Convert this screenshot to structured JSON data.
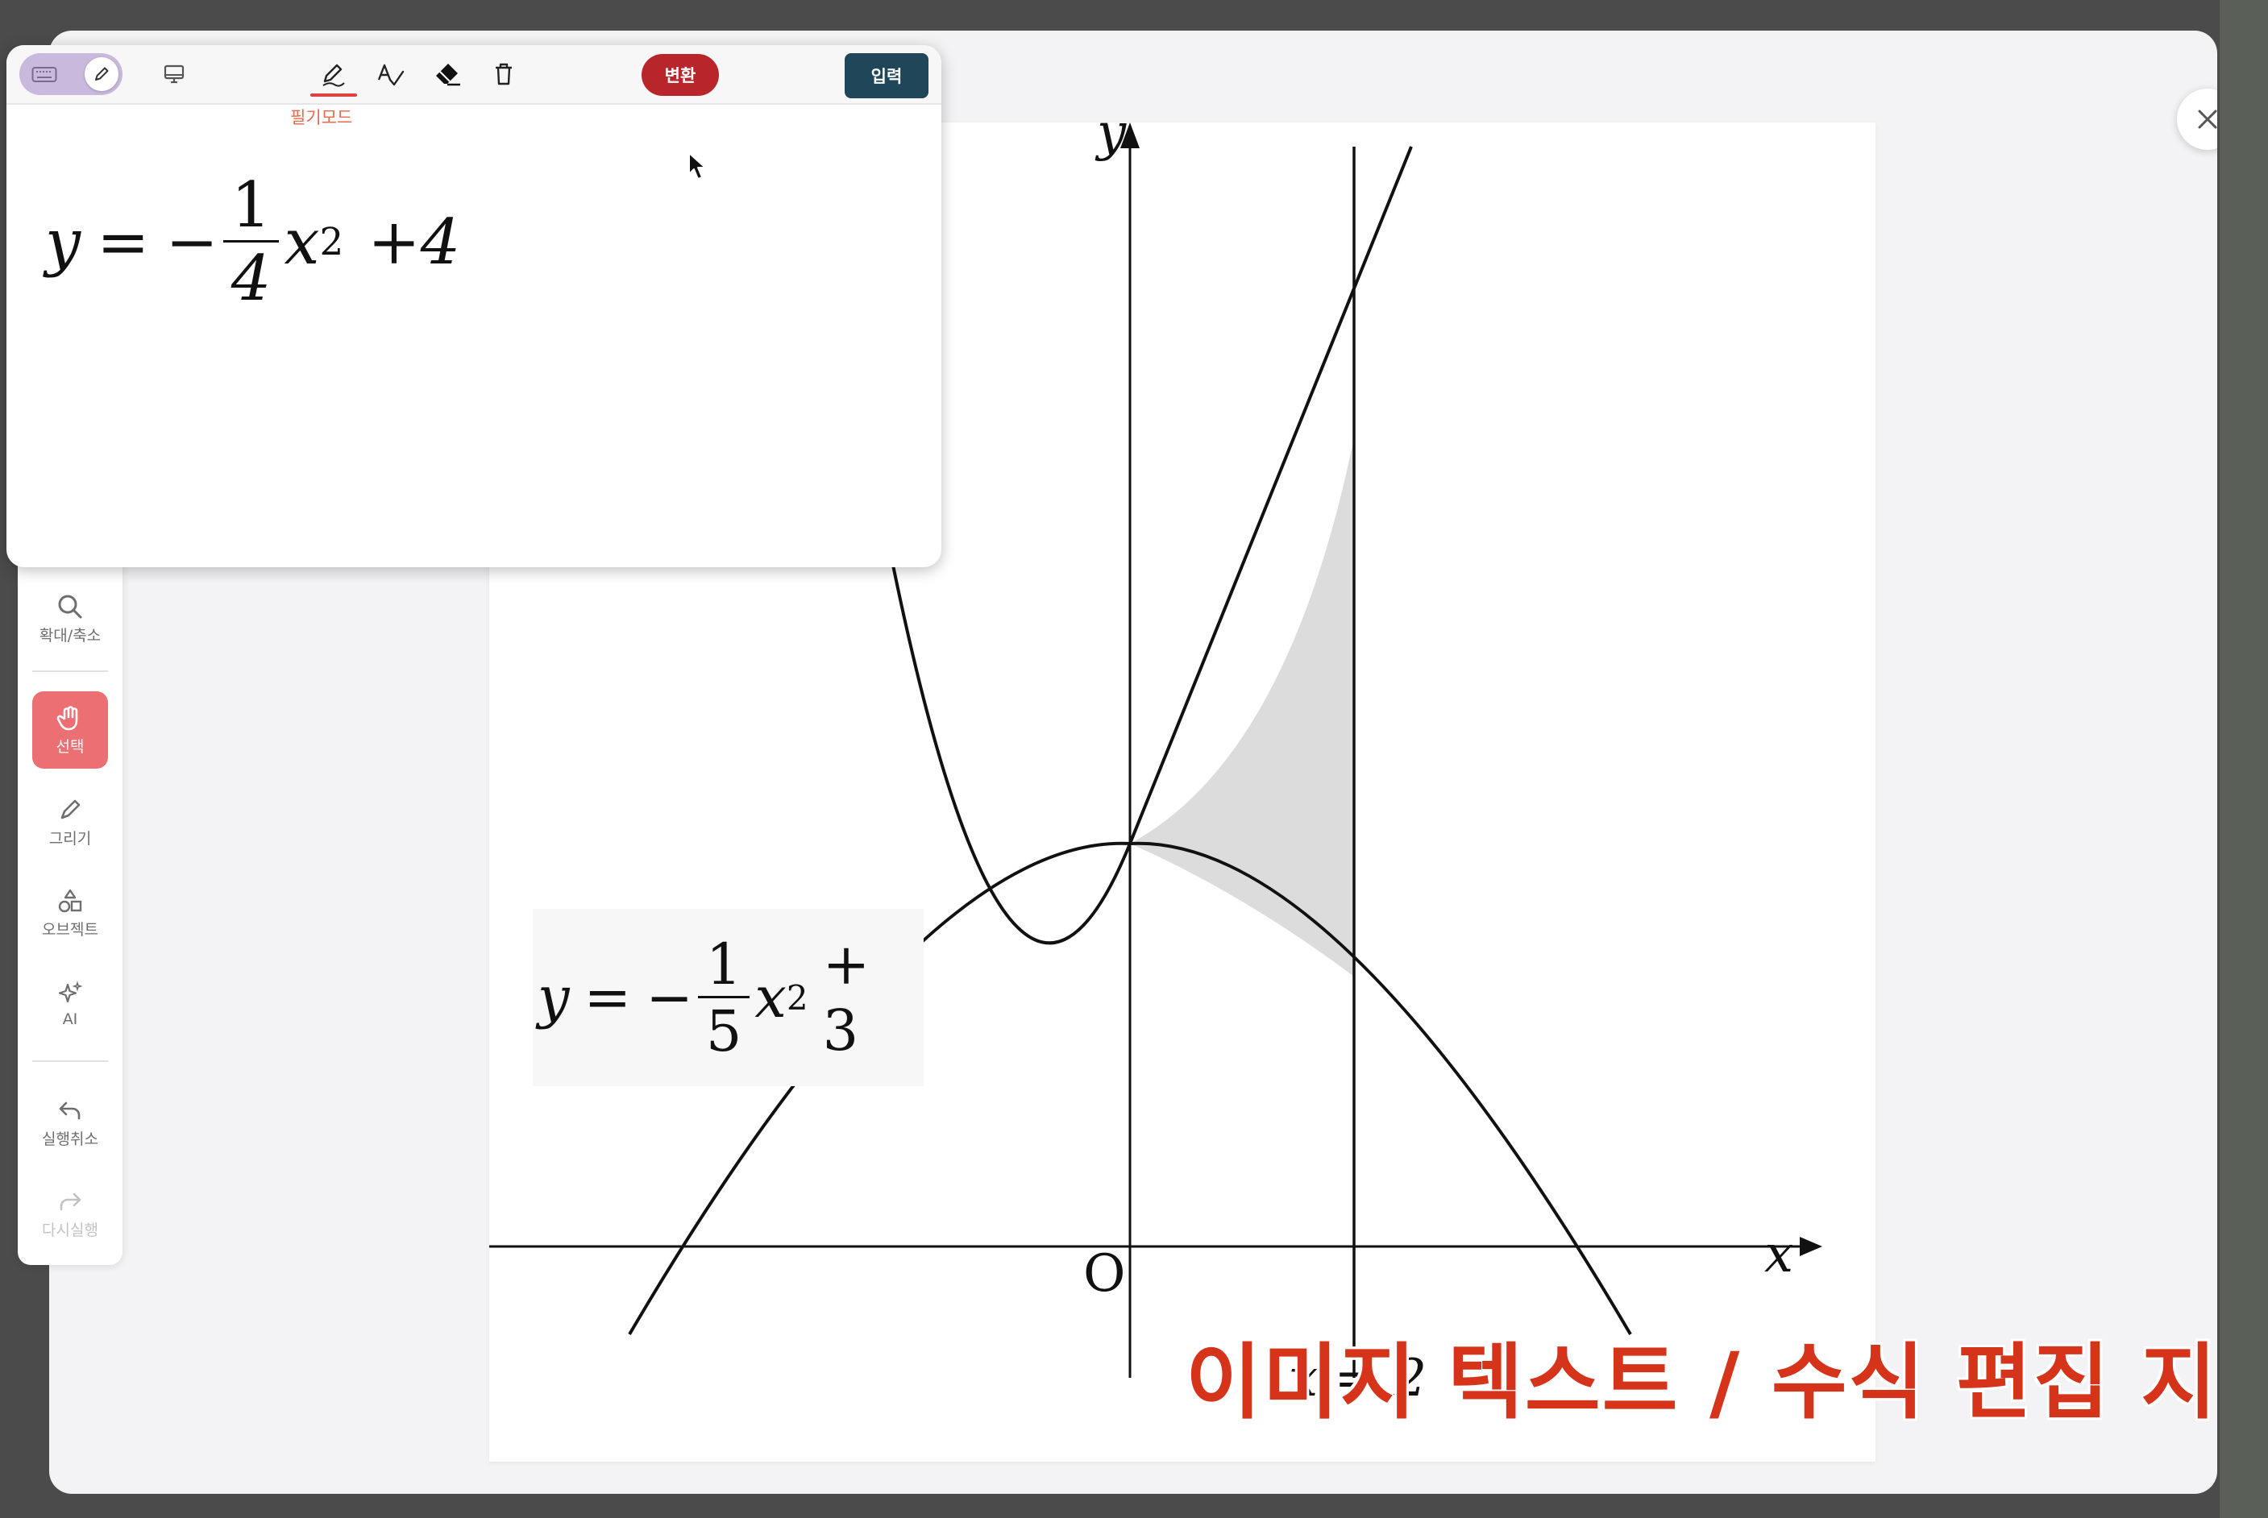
{
  "editor": {
    "toolbar": {
      "convert_label": "변환",
      "enter_label": "입력",
      "pen_mode_label": "필기모드"
    },
    "handwritten_equation": {
      "lhs": "y",
      "equals": "=",
      "sign": "−",
      "numerator": "1",
      "denominator": "4",
      "var": "x",
      "exponent": "2",
      "tail": "+4"
    }
  },
  "sidebar": {
    "items": [
      {
        "label": "확대/축소",
        "icon": "magnifier-icon"
      },
      {
        "label": "선택",
        "icon": "hand-icon",
        "active": true
      },
      {
        "label": "그리기",
        "icon": "pen-icon"
      },
      {
        "label": "오브젝트",
        "icon": "shapes-icon"
      },
      {
        "label": "AI",
        "icon": "sparkle-icon"
      },
      {
        "label": "실행취소",
        "icon": "undo-icon"
      },
      {
        "label": "다시실행",
        "icon": "redo-icon",
        "disabled": true
      }
    ]
  },
  "figure": {
    "axis_y_label": "y",
    "axis_x_label": "x",
    "origin_label": "O",
    "line_label": "x = 2",
    "equation": {
      "lhs": "y",
      "equals": "=",
      "sign": "−",
      "numerator": "1",
      "denominator": "5",
      "var": "x",
      "exponent": "2",
      "tail": "+ 3"
    }
  },
  "caption": "이미지 텍스트 / 수식 편집 지원",
  "colors": {
    "accent_red": "#b8262c",
    "enter_btn": "#1f4659",
    "active_tool": "#ec6f73",
    "caption": "#d5341b"
  }
}
